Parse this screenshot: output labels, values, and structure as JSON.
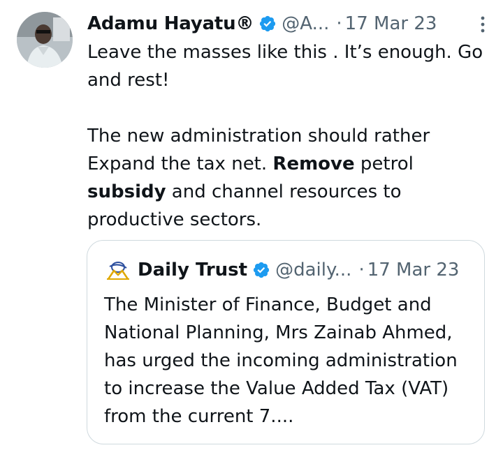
{
  "tweet": {
    "author_name": "Adamu Hayatu®",
    "handle": "@A...",
    "separator": "·",
    "date": "17 Mar 23",
    "text": {
      "line1": "Leave the masses like this . It’s enough. Go and rest!",
      "p2_a": "The new administration should rather Expand the tax net. ",
      "p2_b_bold": "Remove",
      "p2_c": " petrol ",
      "p2_d_bold": "subsidy",
      "p2_e": " and channel resources to productive sectors."
    }
  },
  "quoted": {
    "author_name": "Daily Trust",
    "handle": "@daily...",
    "separator": "·",
    "date": "17 Mar 23",
    "text": "The Minister of Finance, Budget and National Planning, Mrs Zainab Ahmed, has urged the incoming administration to increase the Value Added Tax (VAT) from the current 7...."
  },
  "colors": {
    "text": "#0f1419",
    "secondary": "#536471",
    "verified": "#1d9bf0",
    "border": "#cfd9de"
  },
  "icons": {
    "verified": "verified-badge-icon",
    "more": "more-vertical-icon",
    "logo": "daily-trust-logo"
  }
}
